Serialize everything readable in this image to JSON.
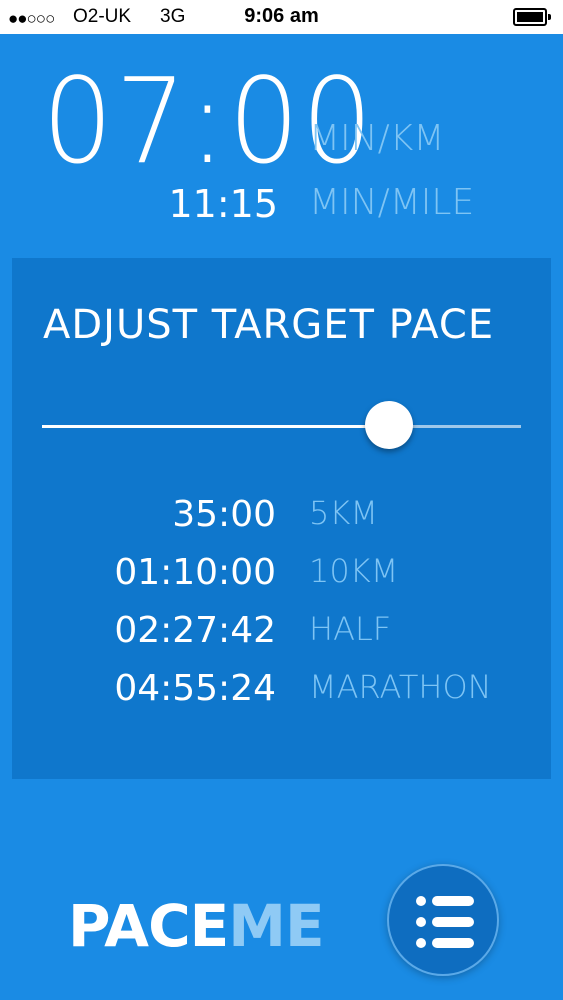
{
  "status_bar": {
    "signal": "●●○○○",
    "carrier": "O2-UK",
    "network": "3G",
    "time": "9:06 am",
    "battery_icon": "battery-full-icon"
  },
  "pace": {
    "per_km": "07:00",
    "per_km_unit": "MIN/KM",
    "per_mile": "11:15",
    "per_mile_unit": "MIN/MILE"
  },
  "adjust_panel": {
    "title": "ADJUST TARGET PACE",
    "slider_value_fraction": 0.725,
    "race_times": [
      {
        "time": "35:00",
        "label": "5KM"
      },
      {
        "time": "01:10:00",
        "label": "10KM"
      },
      {
        "time": "02:27:42",
        "label": "HALF"
      },
      {
        "time": "04:55:24",
        "label": "MARATHON"
      }
    ]
  },
  "branding": {
    "logo_part1": "PACE",
    "logo_part2": "ME"
  },
  "menu_button": {
    "icon": "menu-list-icon"
  },
  "colors": {
    "background": "#1a8be4",
    "panel": "#0f77cc",
    "accent_text": "#7ec4f4"
  }
}
